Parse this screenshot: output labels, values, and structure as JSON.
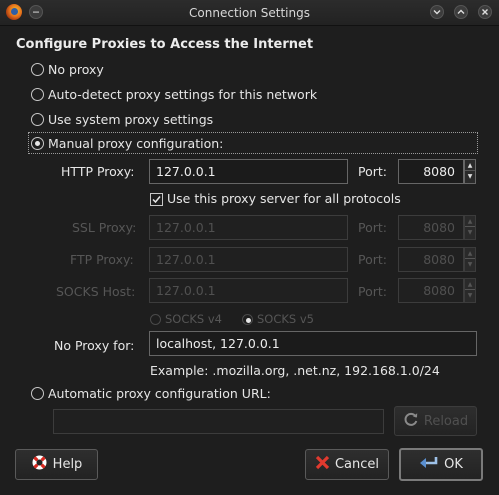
{
  "window": {
    "title": "Connection Settings"
  },
  "heading": "Configure Proxies to Access the Internet",
  "options": {
    "no_proxy": "No proxy",
    "auto_detect": "Auto-detect proxy settings for this network",
    "system": "Use system proxy settings",
    "manual": "Manual proxy configuration:",
    "auto_url": "Automatic proxy configuration URL:"
  },
  "selected_option": "manual",
  "http": {
    "label": "HTTP Proxy:",
    "value": "127.0.0.1",
    "port_label": "Port:",
    "port": "8080"
  },
  "use_for_all": {
    "label": "Use this proxy server for all protocols",
    "checked": true
  },
  "ssl": {
    "label": "SSL Proxy:",
    "value": "127.0.0.1",
    "port_label": "Port:",
    "port": "8080"
  },
  "ftp": {
    "label": "FTP Proxy:",
    "value": "127.0.0.1",
    "port_label": "Port:",
    "port": "8080"
  },
  "socks": {
    "label": "SOCKS Host:",
    "value": "127.0.0.1",
    "port_label": "Port:",
    "port": "8080"
  },
  "socks_version": {
    "v4": "SOCKS v4",
    "v5": "SOCKS v5",
    "selected": "v5"
  },
  "no_proxy_for": {
    "label": "No Proxy for:",
    "value": "localhost, 127.0.0.1"
  },
  "example": "Example: .mozilla.org, .net.nz, 192.168.1.0/24",
  "auto_url": {
    "value": "",
    "reload_label": "Reload"
  },
  "buttons": {
    "help": "Help",
    "cancel": "Cancel",
    "ok": "OK"
  }
}
